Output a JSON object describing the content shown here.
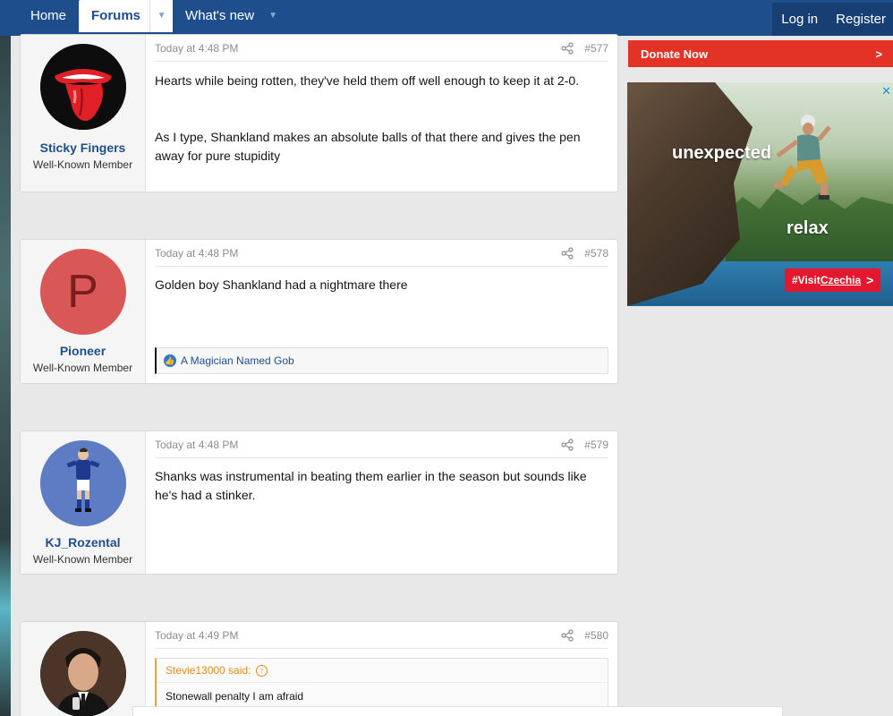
{
  "nav": {
    "home": "Home",
    "forums": "Forums",
    "whats_new": "What's new",
    "login": "Log in",
    "register": "Register"
  },
  "sidebar": {
    "donate_label": "Donate Now",
    "donate_arrow": ">",
    "ad": {
      "headline": "unexpected",
      "subline": "relax",
      "badge_prefix": "#Visit",
      "badge_brand": "Czechia",
      "badge_arrow": ">",
      "close": "✕"
    }
  },
  "posts": [
    {
      "username": "Sticky Fingers",
      "title": "Well-Known Member",
      "time": "Today at 4:48 PM",
      "number": "#577",
      "paragraphs": [
        "Hearts while being rotten, they've held them off well enough to keep it at 2-0.",
        "As I type, Shankland makes an absolute balls of that there and gives the pen away for pure stupidity"
      ]
    },
    {
      "username": "Pioneer",
      "title": "Well-Known Member",
      "avatar_letter": "P",
      "time": "Today at 4:48 PM",
      "number": "#578",
      "paragraphs": [
        "Golden boy Shankland had a nightmare there"
      ],
      "reaction": "A Magician Named Gob"
    },
    {
      "username": "KJ_Rozental",
      "title": "Well-Known Member",
      "time": "Today at 4:48 PM",
      "number": "#579",
      "paragraphs": [
        "Shanks was instrumental in beating them earlier in the season but sounds like he's had a stinker."
      ]
    },
    {
      "time": "Today at 4:49 PM",
      "number": "#580",
      "quote_author": "Stevie13000 said:",
      "quote_text": "Stonewall penalty I am afraid"
    }
  ],
  "colors": {
    "nav_bg": "#1f4e8c",
    "link": "#1f4e8c",
    "donate_bg": "#e23326",
    "quote_accent": "#e88a1a",
    "pioneer_avatar": "#d95757"
  }
}
